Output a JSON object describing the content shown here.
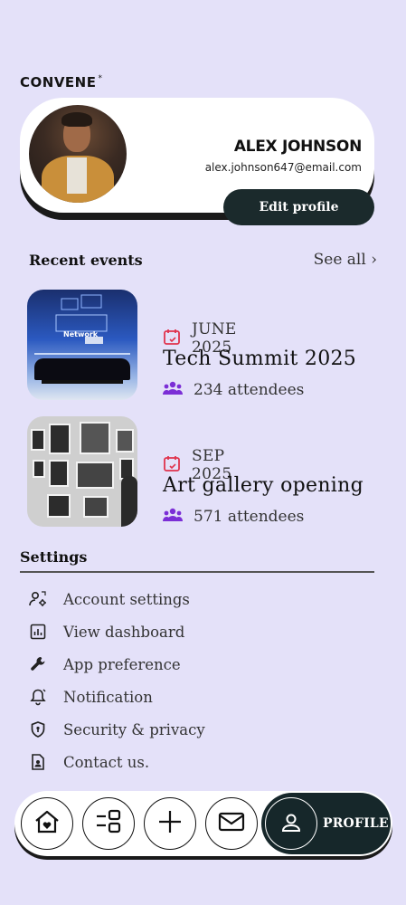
{
  "app": {
    "brand": "CONVENE",
    "brand_mark": "*"
  },
  "profile": {
    "name": "ALEX JOHNSON",
    "email": "alex.johnson647@email.com",
    "edit_label": "Edit profile"
  },
  "recent": {
    "title": "Recent events",
    "see_all": "See all ›",
    "events": [
      {
        "date": "JUNE 2025",
        "name": "Tech Summit 2025",
        "attendees": "234 attendees",
        "thumb_text": "Network"
      },
      {
        "date": "SEP 2025",
        "name": "Art gallery opening",
        "attendees": "571 attendees"
      }
    ]
  },
  "settings": {
    "title": "Settings",
    "items": [
      {
        "label": "Account settings",
        "icon": "account-settings-icon"
      },
      {
        "label": "View dashboard",
        "icon": "dashboard-icon"
      },
      {
        "label": "App preference",
        "icon": "wrench-icon"
      },
      {
        "label": "Notification",
        "icon": "bell-icon"
      },
      {
        "label": "Security & privacy",
        "icon": "shield-icon"
      },
      {
        "label": "Contact us.",
        "icon": "contact-icon"
      }
    ]
  },
  "nav": {
    "items": [
      "home-icon",
      "menu-icon",
      "plus-icon",
      "mail-icon",
      "profile-icon"
    ],
    "active_label": "PROFILE"
  },
  "colors": {
    "background": "#e4e1f9",
    "dark": "#1b2a2c",
    "date_icon": "#e0334d",
    "people_icon": "#7b2ed6"
  }
}
